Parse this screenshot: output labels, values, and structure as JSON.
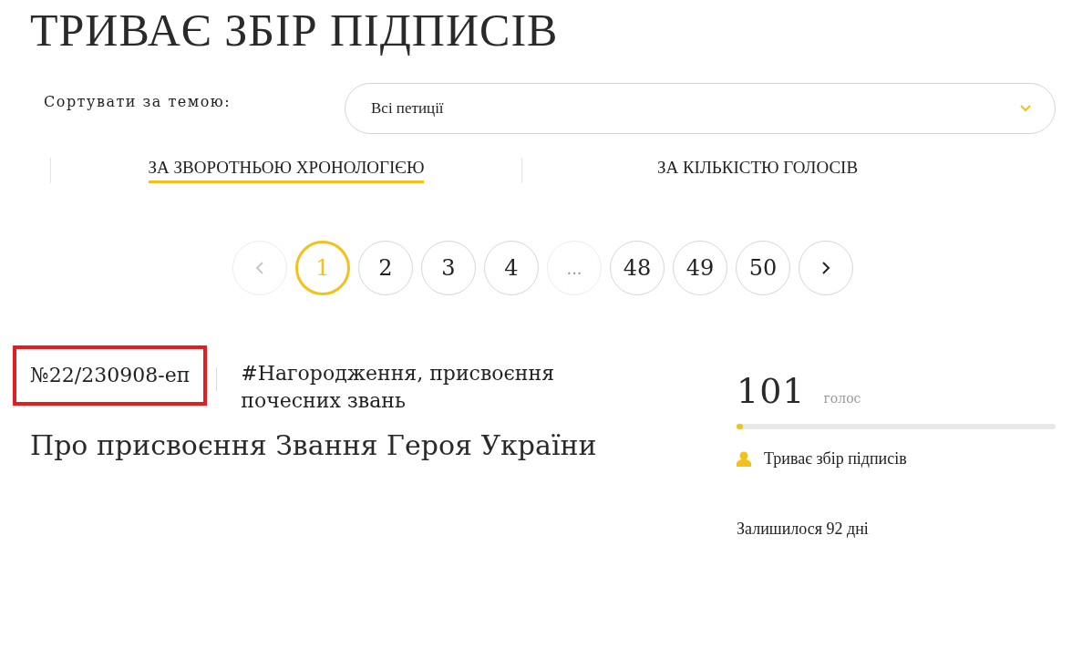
{
  "heading": "ТРИВАЄ ЗБІР ПІДПИСІВ",
  "filter": {
    "label": "Сортувати за темою:",
    "value": "Всі петиції"
  },
  "sort_tabs": [
    {
      "label": "ЗА ЗВОРОТНЬОЮ ХРОНОЛОГІЄЮ",
      "selected": true
    },
    {
      "label": "ЗА КІЛЬКІСТЮ ГОЛОСІВ",
      "selected": false
    }
  ],
  "pagination": [
    {
      "kind": "prev",
      "disabled": true,
      "selected": false
    },
    {
      "kind": "page",
      "label": "1",
      "disabled": false,
      "selected": true
    },
    {
      "kind": "page",
      "label": "2",
      "disabled": false,
      "selected": false
    },
    {
      "kind": "page",
      "label": "3",
      "disabled": false,
      "selected": false
    },
    {
      "kind": "page",
      "label": "4",
      "disabled": false,
      "selected": false
    },
    {
      "kind": "ellipsis",
      "label": "...",
      "disabled": true,
      "selected": false
    },
    {
      "kind": "page",
      "label": "48",
      "disabled": false,
      "selected": false
    },
    {
      "kind": "page",
      "label": "49",
      "disabled": false,
      "selected": false
    },
    {
      "kind": "page",
      "label": "50",
      "disabled": false,
      "selected": false
    },
    {
      "kind": "next",
      "disabled": false,
      "selected": false
    }
  ],
  "petition": {
    "number": "№22/230908-еп",
    "highlighted": true,
    "tag": "#Нагородження, присвоєння почесних звань",
    "title": "Про присвоєння Звання Героя України",
    "votes": "101",
    "votes_unit": "голос",
    "level": 0.02,
    "status": "Триває збір підписів",
    "remaining": "Залишилося 92 дні"
  }
}
